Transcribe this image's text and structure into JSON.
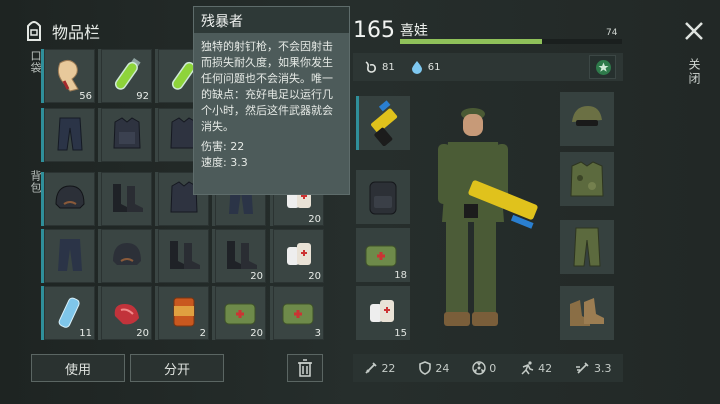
{
  "inventory": {
    "title": "物品栏",
    "pocket_label": "口袋",
    "backpack_label": "背包",
    "counts": {
      "r1c1": "56",
      "r1c2": "92",
      "r2c5": "20",
      "r3c5": "20",
      "r4c4": "20",
      "r4c5": "20",
      "r5c1": "11",
      "r5c2": "20",
      "r5c3": "2",
      "r5c4": "20",
      "r5c5": "3"
    },
    "use_label": "使用",
    "split_label": "分开"
  },
  "tooltip": {
    "name": "残暴者",
    "description": "独特的射钉枪，不会因射击而损失耐久度，如果你发生任何问题也不会消失。唯一的缺点：充好电足以运行几个小时，然后这件武器就会消失。",
    "damage": "伤害: 22",
    "speed": "速度: 3.3"
  },
  "character": {
    "level": "165",
    "name": "喜娃",
    "hp_max": "74",
    "hp_fraction": 0.64,
    "food": "81",
    "water": "61"
  },
  "gear_counts": {
    "medkit": "18",
    "bandage": "15"
  },
  "stats": {
    "attack": "22",
    "defense": "24",
    "radiation": "0",
    "speed_move": "42",
    "attack_speed": "3.3"
  },
  "close_label": "关闭",
  "colors": {
    "accent_border": "#2f8f9a",
    "hp_bar": "#8fc15a"
  }
}
